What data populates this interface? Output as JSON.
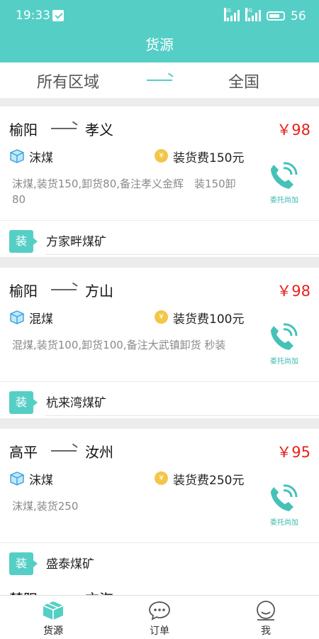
{
  "status_bar": {
    "time": "19:33",
    "net1": "4G",
    "net2": "4G",
    "battery": "56"
  },
  "header": {
    "title": "货源"
  },
  "filter": {
    "from": "所有区域",
    "to": "全国"
  },
  "cards": [
    {
      "from": "榆阳",
      "to": "孝义",
      "price": "￥98",
      "cargo": "沫煤",
      "fee": "装货费150元",
      "note": "沫煤,装货150,卸货80,备注孝义金辉　装150卸80",
      "action": "委托尚加",
      "tag": "装",
      "mine": "方家畔煤矿"
    },
    {
      "from": "榆阳",
      "to": "方山",
      "price": "￥98",
      "cargo": "混煤",
      "fee": "装货费100元",
      "note": "混煤,装货100,卸货100,备注大武镇卸货 秒装",
      "action": "委托尚加",
      "tag": "装",
      "mine": "杭来湾煤矿"
    },
    {
      "from": "高平",
      "to": "汝州",
      "price": "￥95",
      "cargo": "沫煤",
      "fee": "装货费250元",
      "note": "沫煤,装货250",
      "action": "委托尚加",
      "tag": "装",
      "mine": "盛泰煤矿"
    }
  ],
  "peek": {
    "from": "楚阳",
    "to": "方海"
  },
  "tabs": [
    {
      "label": "货源",
      "icon": "box-icon"
    },
    {
      "label": "订单",
      "icon": "chat-icon"
    },
    {
      "label": "我",
      "icon": "face-icon"
    }
  ],
  "colors": {
    "accent": "#55cfc6",
    "price": "#e8201c",
    "coin": "#f3c64a"
  }
}
